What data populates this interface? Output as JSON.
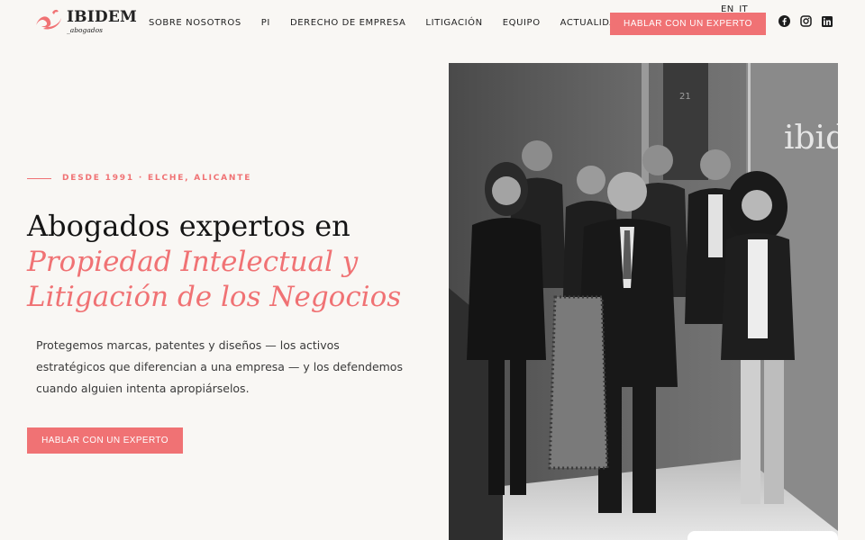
{
  "brand": {
    "name": "IBIDEM",
    "tagline": "_abogados",
    "accent_color": "#f07274"
  },
  "nav": {
    "items": [
      {
        "label": "SOBRE NOSOTROS"
      },
      {
        "label": "PI"
      },
      {
        "label": "DERECHO DE EMPRESA"
      },
      {
        "label": "LITIGACIÓN"
      },
      {
        "label": "EQUIPO"
      },
      {
        "label": "ACTUALIDAD"
      }
    ],
    "languages": [
      "EN",
      "IT"
    ],
    "cta_label": "HABLAR CON UN EXPERTO",
    "social": [
      {
        "icon": "facebook-icon"
      },
      {
        "icon": "instagram-icon"
      },
      {
        "icon": "linkedin-icon"
      }
    ]
  },
  "hero": {
    "eyebrow": "DESDE 1991 · ELCHE, ALICANTE",
    "headline": "Abogados expertos en",
    "headline_accent_line1": "Propiedad Intelectual y",
    "headline_accent_line2": "Litigación de los Negocios",
    "lead": "Protegemos marcas, patentes y diseños — los activos estratégicos que diferencian a una empresa — y los defendemos cuando alguien intenta apropiárselos.",
    "cta_label": "HABLAR CON UN EXPERTO",
    "image_sign_text": "ibid",
    "image_door_number": "21"
  }
}
